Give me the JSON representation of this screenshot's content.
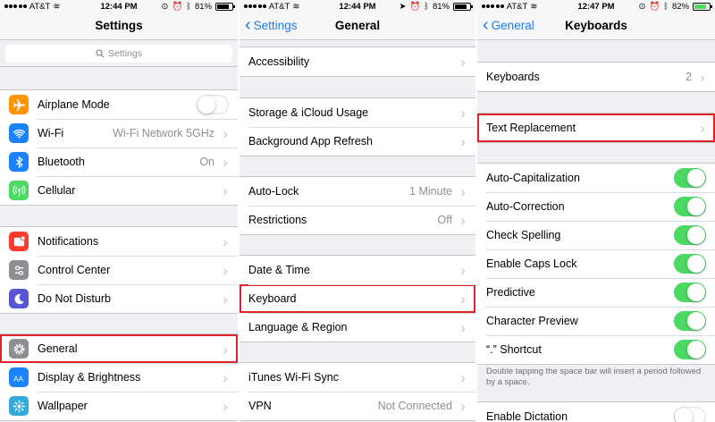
{
  "screen1": {
    "status": {
      "carrier": "AT&T",
      "time": "12:44 PM",
      "battery": "81%",
      "battery_level": 0.81
    },
    "title": "Settings",
    "search_placeholder": "Settings",
    "groups": [
      [
        {
          "label": "Airplane Mode",
          "icon": "airplane-icon",
          "color": "#ff9500",
          "control": "toggle",
          "on": false
        },
        {
          "label": "Wi-Fi",
          "icon": "wifi-icon",
          "color": "#1a82fb",
          "value": "Wi-Fi Network 5GHz"
        },
        {
          "label": "Bluetooth",
          "icon": "bluetooth-icon",
          "color": "#1a82fb",
          "value": "On"
        },
        {
          "label": "Cellular",
          "icon": "cellular-icon",
          "color": "#4cd964"
        }
      ],
      [
        {
          "label": "Notifications",
          "icon": "notifications-icon",
          "color": "#ff3b30"
        },
        {
          "label": "Control Center",
          "icon": "control-center-icon",
          "color": "#8e8e93"
        },
        {
          "label": "Do Not Disturb",
          "icon": "moon-icon",
          "color": "#5856d6"
        }
      ],
      [
        {
          "label": "General",
          "icon": "gear-icon",
          "color": "#8e8e93",
          "highlight": true
        },
        {
          "label": "Display & Brightness",
          "icon": "display-icon",
          "color": "#1a82fb"
        },
        {
          "label": "Wallpaper",
          "icon": "wallpaper-icon",
          "color": "#34aadc"
        }
      ]
    ]
  },
  "screen2": {
    "status": {
      "carrier": "AT&T",
      "time": "12:44 PM",
      "battery": "81%",
      "battery_level": 0.81
    },
    "back": "Settings",
    "title": "General",
    "groups": [
      [
        {
          "label": "Accessibility"
        }
      ],
      [
        {
          "label": "Storage & iCloud Usage"
        },
        {
          "label": "Background App Refresh"
        }
      ],
      [
        {
          "label": "Auto-Lock",
          "value": "1 Minute"
        },
        {
          "label": "Restrictions",
          "value": "Off"
        }
      ],
      [
        {
          "label": "Date & Time"
        },
        {
          "label": "Keyboard",
          "highlight": true
        },
        {
          "label": "Language & Region"
        }
      ],
      [
        {
          "label": "iTunes Wi-Fi Sync"
        },
        {
          "label": "VPN",
          "value": "Not Connected"
        }
      ]
    ]
  },
  "screen3": {
    "status": {
      "carrier": "AT&T",
      "time": "12:47 PM",
      "battery": "82%",
      "battery_level": 0.82
    },
    "back": "General",
    "title": "Keyboards",
    "groups": [
      [
        {
          "label": "Keyboards",
          "value": "2"
        }
      ],
      [
        {
          "label": "Text Replacement",
          "highlight": true
        }
      ],
      [
        {
          "label": "Auto-Capitalization",
          "control": "toggle",
          "on": true
        },
        {
          "label": "Auto-Correction",
          "control": "toggle",
          "on": true
        },
        {
          "label": "Check Spelling",
          "control": "toggle",
          "on": true
        },
        {
          "label": "Enable Caps Lock",
          "control": "toggle",
          "on": true
        },
        {
          "label": "Predictive",
          "control": "toggle",
          "on": true
        },
        {
          "label": "Character Preview",
          "control": "toggle",
          "on": true
        },
        {
          "label": "“.” Shortcut",
          "control": "toggle",
          "on": true
        }
      ],
      [
        {
          "label": "Enable Dictation",
          "control": "toggle",
          "on": false
        }
      ]
    ],
    "footnote": "Double tapping the space bar will insert a period followed by a space."
  },
  "colors": {
    "accent": "#1a7cf5",
    "toggle_on": "#4cd964",
    "highlight_border": "#e0222a"
  }
}
